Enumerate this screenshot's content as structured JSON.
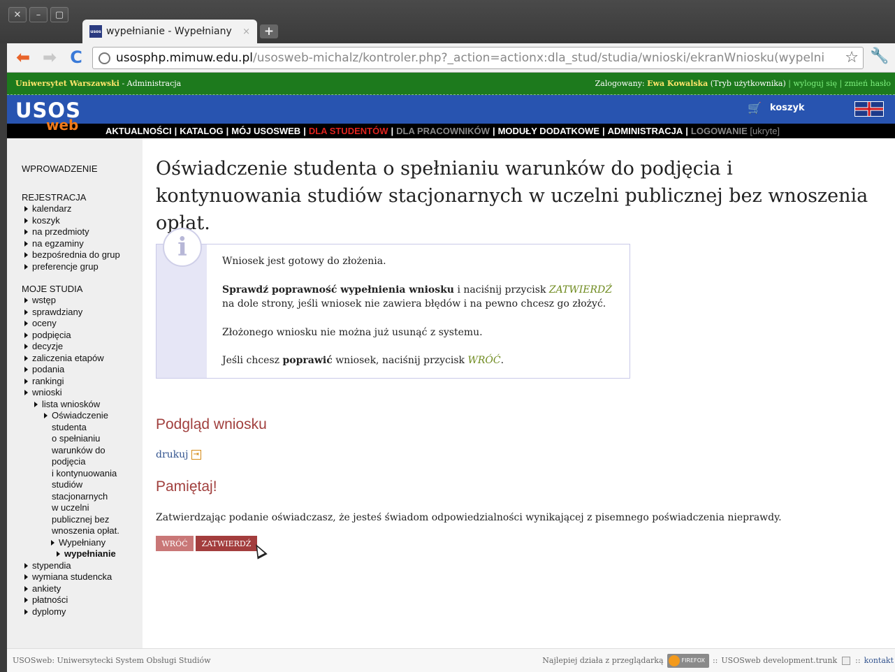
{
  "browser": {
    "tab_title": "wypełnianie - Wypełniany",
    "tab_close": "×",
    "new_tab": "+",
    "favicon_text": "usos",
    "url_host": "usosphp.mimuw.edu.pl",
    "url_path": "/usosweb-michalz/kontroler.php?_action=actionx:dla_stud/studia/wnioski/ekranWniosku(wypelni",
    "buttons": {
      "close": "✕",
      "minimize": "–",
      "maximize": "▢",
      "back": "⬅",
      "forward": "➡",
      "reload": "C",
      "star": "☆",
      "wrench": "🔧"
    }
  },
  "topstrip": {
    "university": "Uniwersytet Warszawski",
    "section": " - Administracja",
    "logged_label": "Zalogowany: ",
    "user": "Ewa Kowalska",
    "mode": " (Tryb użytkownika)",
    "sep1": " | ",
    "logout": "wyloguj się",
    "sep2": " | ",
    "change_password": "zmień hasło"
  },
  "banner": {
    "logo_main": "USOS",
    "logo_sub": "web",
    "cart_label": "koszyk",
    "cart_icon": "cart-icon",
    "menu": [
      {
        "label": "AKTUALNOŚCI",
        "style": "normal"
      },
      {
        "label": "KATALOG",
        "style": "normal"
      },
      {
        "label": "MÓJ USOSWEB",
        "style": "normal"
      },
      {
        "label": "DLA STUDENTÓW",
        "style": "active"
      },
      {
        "label": "DLA PRACOWNIKÓW",
        "style": "dim"
      },
      {
        "label": "MODUŁY DODATKOWE",
        "style": "normal"
      },
      {
        "label": "ADMINISTRACJA",
        "style": "normal"
      },
      {
        "label": "LOGOWANIE",
        "style": "dim"
      }
    ],
    "menu_sep": "|",
    "hidden_label": "[ukryte]"
  },
  "sidebar": {
    "intro": "WPROWADZENIE",
    "registration": {
      "title": "REJESTRACJA",
      "items": [
        "kalendarz",
        "koszyk",
        "na przedmioty",
        "na egzaminy",
        "bezpośrednia do grup",
        "preferencje grup"
      ]
    },
    "studies": {
      "title": "MOJE STUDIA",
      "items": [
        "wstęp",
        "sprawdziany",
        "oceny",
        "podpięcia",
        "decyzje",
        "zaliczenia etapów",
        "podania",
        "rankingi",
        "wnioski"
      ],
      "list": "lista wniosków",
      "declaration": "Oświadczenie",
      "declaration_rest": [
        "studenta",
        "o spełnianiu",
        "warunków do",
        "podjęcia",
        "i kontynuowania",
        "studiów",
        "stacjonarnych",
        "w uczelni",
        "publicznej bez",
        "wnoszenia opłat."
      ],
      "filled": "Wypełniany",
      "filling": "wypełnianie",
      "more": [
        "stypendia",
        "wymiana studencka",
        "ankiety",
        "płatności",
        "dyplomy"
      ]
    }
  },
  "main": {
    "title": "Oświadczenie studenta o spełnianiu warunków do podjęcia i kontynuowania studiów stacjonarnych w uczelni publicznej bez wnoszenia opłat.",
    "info": {
      "icon": "i",
      "p1": "Wniosek jest gotowy do złożenia.",
      "p2_bold": "Sprawdź poprawność wypełnienia wniosku",
      "p2_mid": " i naciśnij przycisk ",
      "p2_btn": "ZATWIERDŹ",
      "p2_end": " na dole strony, jeśli wniosek nie zawiera błędów i na pewno chcesz go złożyć.",
      "p3": "Złożonego wniosku nie można już usunąć z systemu.",
      "p4_start": "Jeśli chcesz ",
      "p4_bold": "poprawić",
      "p4_mid": " wniosek, naciśnij przycisk ",
      "p4_btn": "WRÓĆ",
      "p4_end": "."
    },
    "preview_heading": "Podgląd wniosku",
    "print_link": "drukuj",
    "print_icon": "⇥",
    "remember_heading": "Pamiętaj!",
    "notice": "Zatwierdzając podanie oświadczasz, że jesteś świadom odpowiedzialności wynikającej z pisemnego poświadczenia nieprawdy.",
    "btn_back": "WRÓĆ",
    "btn_submit": "ZATWIERDŹ"
  },
  "footer": {
    "left": "USOSweb: Uniwersytecki System Obsługi Studiów",
    "best_in": "Najlepiej działa z przeglądarką",
    "firefox": "FIREFOX",
    "sep": " :: ",
    "version": "USOSweb development.trunk",
    "sep2": " :: ",
    "contact": "kontakt"
  }
}
